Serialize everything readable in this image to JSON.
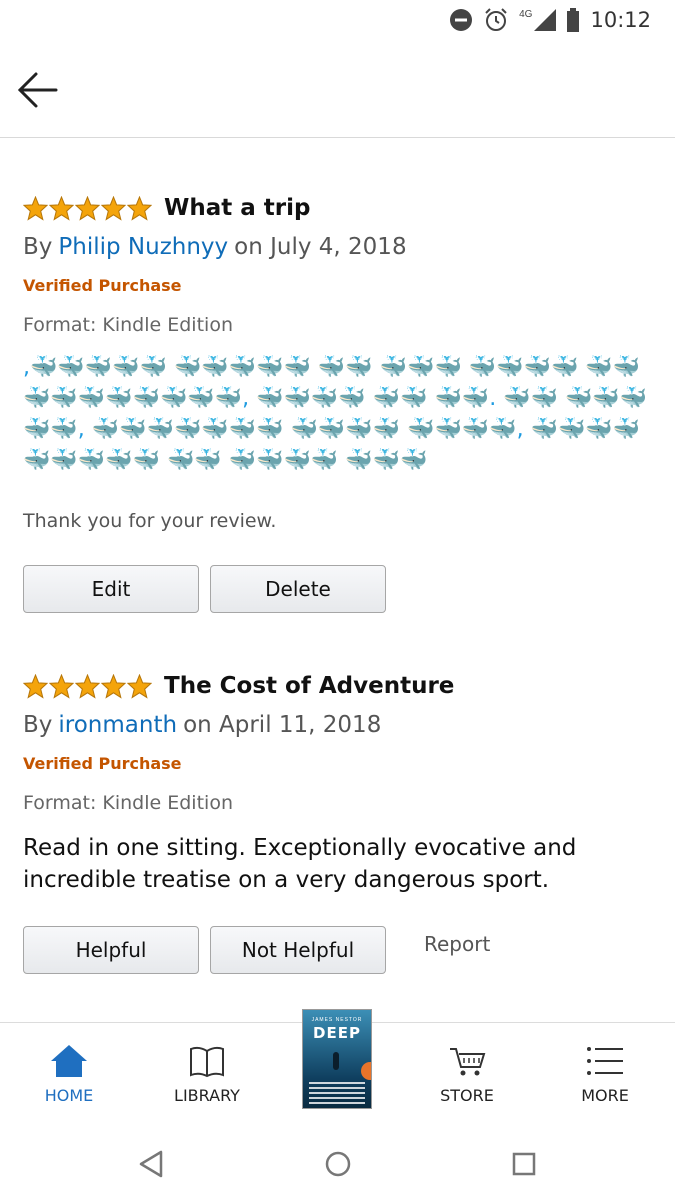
{
  "status_bar": {
    "network": "4G",
    "time": "10:12"
  },
  "reviews": [
    {
      "rating": 5,
      "title": "What a trip",
      "by": "By",
      "author": "Philip Nuzhnyy",
      "date": "on July 4, 2018",
      "verified": "Verified Purchase",
      "format": "Format: Kindle Edition",
      "body": ",🐳🐳🐳🐳🐳 🐳🐳🐳🐳🐳 🐳🐳 🐳🐳🐳 🐳🐳🐳🐳 🐳🐳 🐳🐳🐳🐳🐳🐳🐳🐳, 🐳🐳🐳🐳 🐳🐳 🐳🐳. 🐳🐳 🐳🐳🐳🐳🐳, 🐳🐳🐳🐳🐳🐳🐳 🐳🐳🐳🐳 🐳🐳🐳🐳, 🐳🐳🐳🐳 🐳🐳🐳🐳🐳 🐳🐳 🐳🐳🐳🐳 🐳🐳🐳",
      "thanks": "Thank you for your review.",
      "buttons": {
        "edit": "Edit",
        "delete": "Delete"
      }
    },
    {
      "rating": 5,
      "title": "The Cost of Adventure",
      "by": "By",
      "author": "ironmanth",
      "date": "on April 11, 2018",
      "verified": "Verified Purchase",
      "format": "Format: Kindle Edition",
      "body": "Read in one sitting. Exceptionally evocative and incredible treatise on a very dangerous sport.",
      "buttons": {
        "helpful": "Helpful",
        "not_helpful": "Not Helpful",
        "report": "Report"
      }
    }
  ],
  "bottom_nav": {
    "items": [
      {
        "label": "HOME",
        "icon": "home-icon",
        "active": true
      },
      {
        "label": "LIBRARY",
        "icon": "library-icon",
        "active": false
      },
      {
        "label": "STORE",
        "icon": "cart-icon",
        "active": false
      },
      {
        "label": "MORE",
        "icon": "menu-list-icon",
        "active": false
      }
    ],
    "current_book": {
      "author": "JAMES NESTOR",
      "title": "DEEP"
    }
  },
  "colors": {
    "link": "#0f6cb8",
    "verified": "#c45500",
    "star": "#f4a40b",
    "active_nav": "#1f6fc0"
  }
}
